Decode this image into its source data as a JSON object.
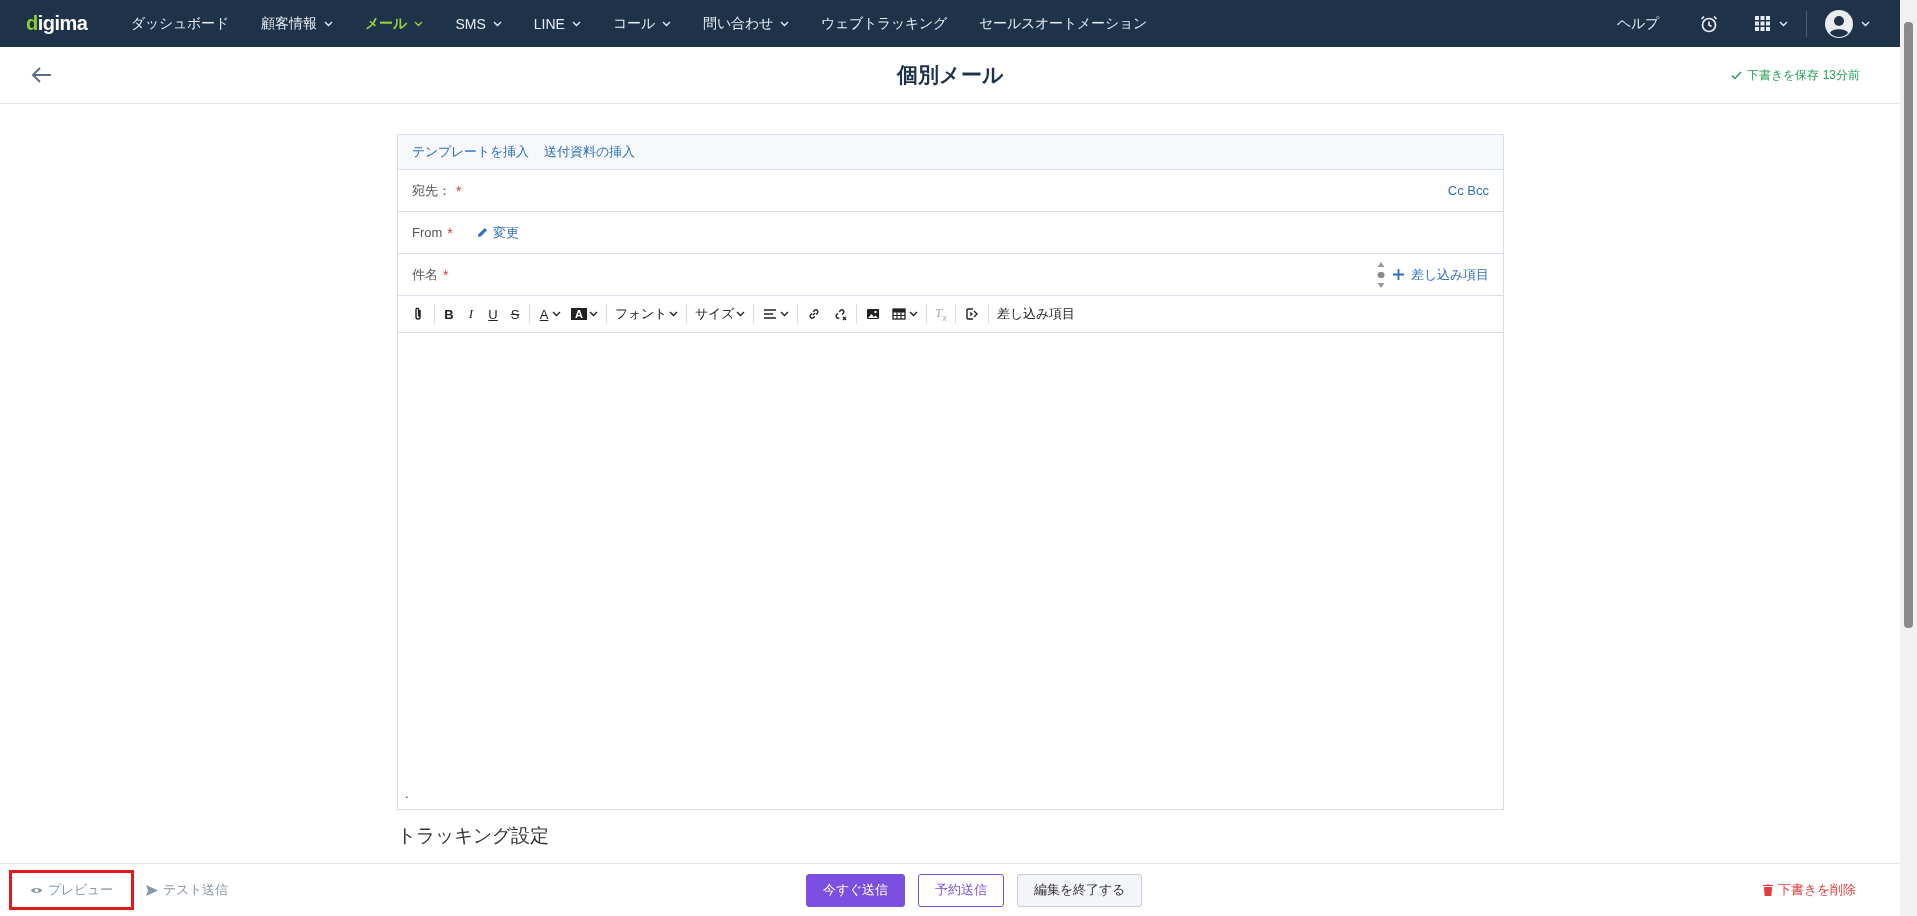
{
  "nav": {
    "logo": "digima",
    "items": [
      {
        "label": "ダッシュボード",
        "dropdown": false,
        "selected": false
      },
      {
        "label": "顧客情報",
        "dropdown": true,
        "selected": false
      },
      {
        "label": "メール",
        "dropdown": true,
        "selected": true
      },
      {
        "label": "SMS",
        "dropdown": true,
        "selected": false
      },
      {
        "label": "LINE",
        "dropdown": true,
        "selected": false
      },
      {
        "label": "コール",
        "dropdown": true,
        "selected": false
      },
      {
        "label": "問い合わせ",
        "dropdown": true,
        "selected": false
      },
      {
        "label": "ウェブトラッキング",
        "dropdown": false,
        "selected": false
      },
      {
        "label": "セールスオートメーション",
        "dropdown": false,
        "selected": false
      }
    ],
    "help": "ヘルプ"
  },
  "header": {
    "title": "個別メール",
    "save_status": "下書きを保存 13分前"
  },
  "form": {
    "links": [
      "テンプレートを挿入",
      "送付資料の挿入"
    ],
    "fields": [
      {
        "kind": "to",
        "label": "宛先：",
        "mark": "*",
        "action": "Cc Bcc"
      },
      {
        "kind": "from",
        "label": "From",
        "mark": "*",
        "action": "変更"
      },
      {
        "kind": "subject",
        "label": "件名",
        "mark": "*",
        "action": "差し込み項目"
      }
    ],
    "toolbar": [
      {
        "kind": "attach"
      },
      {
        "kind": "sep"
      },
      {
        "kind": "bold",
        "label": "B"
      },
      {
        "kind": "italic",
        "label": "I"
      },
      {
        "kind": "underline",
        "label": "U"
      },
      {
        "kind": "strike",
        "label": "S"
      },
      {
        "kind": "sep"
      },
      {
        "kind": "color",
        "label": "A",
        "dropdown": true
      },
      {
        "kind": "highlight",
        "label": "A",
        "dropdown": true
      },
      {
        "kind": "sep"
      },
      {
        "kind": "menu",
        "label": "フォント",
        "dropdown": true
      },
      {
        "kind": "sep"
      },
      {
        "kind": "menu",
        "label": "サイズ",
        "dropdown": true
      },
      {
        "kind": "sep"
      },
      {
        "kind": "align",
        "dropdown": true
      },
      {
        "kind": "sep"
      },
      {
        "kind": "link"
      },
      {
        "kind": "unlink"
      },
      {
        "kind": "sep"
      },
      {
        "kind": "image"
      },
      {
        "kind": "table",
        "dropdown": true
      },
      {
        "kind": "sep"
      },
      {
        "kind": "clear",
        "label": "T$_{x}$",
        "disabled": true
      },
      {
        "kind": "sep"
      },
      {
        "kind": "merge"
      },
      {
        "kind": "sep"
      },
      {
        "kind": "menu",
        "label": "差し込み項目",
        "dropdown": false
      }
    ],
    "body": "."
  },
  "section_heading": "トラッキング設定",
  "footer": {
    "left": [
      {
        "kind": "preview",
        "label": "プレビュー",
        "highlighted": true
      },
      {
        "kind": "test",
        "label": "テスト送信",
        "highlighted": false
      }
    ],
    "center": [
      {
        "kind": "primary",
        "label": "今すぐ送信"
      },
      {
        "kind": "outline",
        "label": "予約送信"
      },
      {
        "kind": "default",
        "label": "編集を終了する"
      }
    ],
    "delete": "下書きを削除"
  }
}
